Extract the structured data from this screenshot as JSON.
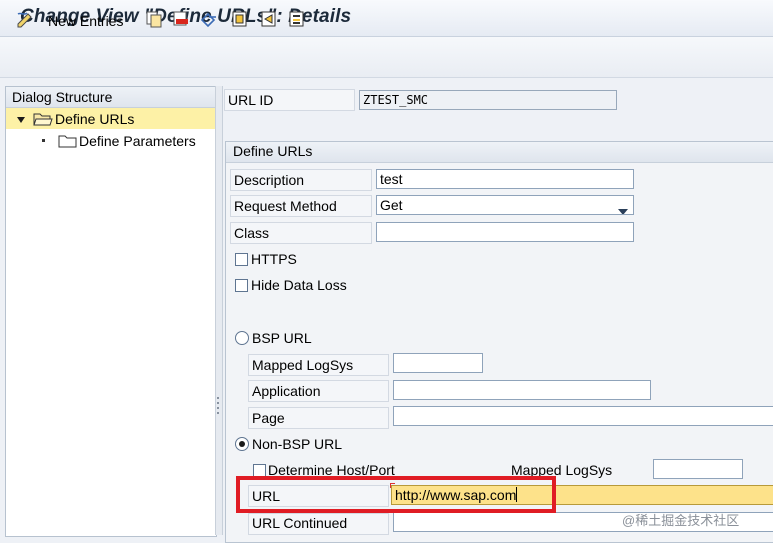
{
  "title": "Change View \"Define URLs\": Details",
  "toolbar": {
    "new_entries_label": "New Entries",
    "icons": [
      "change-display-icon",
      "copy-icon",
      "delete-icon",
      "undo-icon",
      "select-all-icon",
      "select-block-icon",
      "deselect-icon",
      "print-icon"
    ]
  },
  "dialog_structure": {
    "header": "Dialog Structure",
    "items": [
      {
        "label": "Define URLs",
        "selected": true,
        "expanded": true
      },
      {
        "label": "Define Parameters",
        "selected": false
      }
    ]
  },
  "url_id": {
    "label": "URL ID",
    "value": "ZTEST_SMC"
  },
  "group": {
    "title": "Define URLs",
    "description": {
      "label": "Description",
      "value": "test"
    },
    "request_method": {
      "label": "Request Method",
      "value": "Get"
    },
    "class": {
      "label": "Class",
      "value": ""
    },
    "https": {
      "label": "HTTPS",
      "checked": false
    },
    "hide_data_loss": {
      "label": "Hide Data Loss",
      "checked": false
    },
    "bsp_url": {
      "label": "BSP URL",
      "selected": false,
      "mapped_logsys": {
        "label": "Mapped LogSys",
        "value": ""
      },
      "application": {
        "label": "Application",
        "value": ""
      },
      "page": {
        "label": "Page",
        "value": ""
      }
    },
    "non_bsp_url": {
      "label": "Non-BSP  URL",
      "selected": true,
      "determine_host_port": {
        "label": "Determine Host/Port",
        "checked": false
      },
      "mapped_logsys": {
        "label": "Mapped LogSys",
        "value": ""
      },
      "url": {
        "label": "URL",
        "value": "http://www.sap.com"
      },
      "url_continued": {
        "label": "URL Continued",
        "value": ""
      }
    }
  },
  "watermark": "@稀土掘金技术社区",
  "colors": {
    "highlight": "#e01c24",
    "selected_row": "#fdf1a6",
    "active_field": "#fde28a"
  }
}
